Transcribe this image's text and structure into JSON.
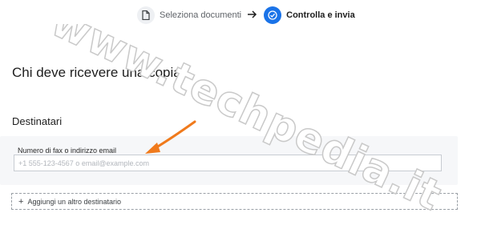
{
  "stepper": {
    "steps": [
      {
        "label": "Seleziona documenti",
        "icon": "document-icon",
        "state": "done"
      },
      {
        "label": "Controlla e invia",
        "icon": "check-circle-icon",
        "state": "active"
      }
    ],
    "separator_icon": "arrow-right-icon"
  },
  "page": {
    "heading": "Chi deve ricevere una copia?",
    "section_title": "Destinatari"
  },
  "recipient": {
    "label": "Numero di fax o indirizzo email",
    "value": "",
    "placeholder": "+1 555-123-4567 o email@example.com"
  },
  "add_recipient": {
    "icon": "plus-icon",
    "label": "Aggiungi un altro destinatario"
  },
  "annotation": {
    "icon": "arrow-pointer-icon",
    "color": "#f07a1c"
  },
  "watermark": {
    "text": "www.techpedia.it"
  },
  "colors": {
    "accent": "#1a73e8",
    "panel": "#f6f7f9"
  }
}
